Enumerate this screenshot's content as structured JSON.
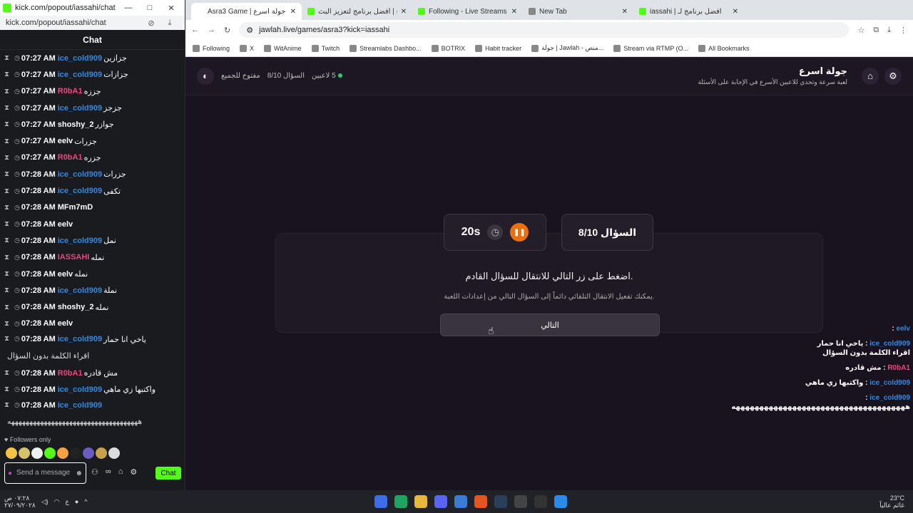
{
  "chat_window": {
    "title": "kick.com/popout/iassahi/chat - Google...",
    "url": "kick.com/popout/iassahi/chat",
    "header": "Chat",
    "followers_only": "Followers only",
    "input_placeholder": "Send a message",
    "send_label": "Chat",
    "messages": [
      {
        "time": "07:27 AM",
        "user": "ice_cold909",
        "user_color": "#2f8ae6",
        "text": "جزازين"
      },
      {
        "time": "07:27 AM",
        "user": "ice_cold909",
        "user_color": "#2f8ae6",
        "text": "جزازات"
      },
      {
        "time": "07:27 AM",
        "user": "R0bA1",
        "user_color": "#e64a7c",
        "text": "جززه"
      },
      {
        "time": "07:27 AM",
        "user": "ice_cold909",
        "user_color": "#2f8ae6",
        "text": "جزجز"
      },
      {
        "time": "07:27 AM",
        "user": "shoshy_2",
        "user_color": "#ffffff",
        "text": "جوازر"
      },
      {
        "time": "07:27 AM",
        "user": "eelv",
        "user_color": "#ffffff",
        "text": "جزرات"
      },
      {
        "time": "07:27 AM",
        "user": "R0bA1",
        "user_color": "#e64a7c",
        "text": "جزره"
      },
      {
        "time": "07:28 AM",
        "user": "ice_cold909",
        "user_color": "#2f8ae6",
        "text": "جزرات"
      },
      {
        "time": "07:28 AM",
        "user": "ice_cold909",
        "user_color": "#2f8ae6",
        "text": "تكفى"
      },
      {
        "time": "07:28 AM",
        "user": "MFm7mD",
        "user_color": "#ffffff",
        "text": ""
      },
      {
        "time": "07:28 AM",
        "user": "eelv",
        "user_color": "#ffffff",
        "text": ""
      },
      {
        "time": "07:28 AM",
        "user": "ice_cold909",
        "user_color": "#2f8ae6",
        "text": "نمل"
      },
      {
        "time": "07:28 AM",
        "user": "IASSAHI",
        "user_color": "#e64a7c",
        "text": "نمله"
      },
      {
        "time": "07:28 AM",
        "user": "eelv",
        "user_color": "#ffffff",
        "text": "نمله"
      },
      {
        "time": "07:28 AM",
        "user": "ice_cold909",
        "user_color": "#2f8ae6",
        "text": "نملة"
      },
      {
        "time": "07:28 AM",
        "user": "shoshy_2",
        "user_color": "#ffffff",
        "text": "نمله"
      },
      {
        "time": "07:28 AM",
        "user": "eelv",
        "user_color": "#ffffff",
        "text": ""
      },
      {
        "time": "07:28 AM",
        "user": "ice_cold909",
        "user_color": "#2f8ae6",
        "text": "ياخي انا حمار",
        "text2": "اقراء الكلمة بدون السؤال"
      },
      {
        "time": "07:28 AM",
        "user": "R0bA1",
        "user_color": "#e64a7c",
        "text": "مش قادره"
      },
      {
        "time": "07:28 AM",
        "user": "ice_cold909",
        "user_color": "#2f8ae6",
        "text": "واكتبها زي ماهي"
      },
      {
        "time": "07:28 AM",
        "user": "ice_cold909",
        "user_color": "#2f8ae6",
        "text": "",
        "text2": "ههههههههههههههههههههههههههههههههههههه"
      }
    ]
  },
  "browser": {
    "tabs": [
      {
        "title": "Asra3 Game | جولة اسرع",
        "color": "#ffffff"
      },
      {
        "title": "الولاء | أفضل برنامج لتعزيز البث",
        "color": "#53fc18"
      },
      {
        "title": "Following - Live Streams on Kick",
        "color": "#53fc18"
      },
      {
        "title": "New Tab",
        "color": "#888888"
      },
      {
        "title": "iassahi | أفضل برنامج لـ",
        "color": "#53fc18"
      }
    ],
    "url": "jawlah.live/games/asra3?kick=iassahi",
    "bookmarks": [
      "Following",
      "X",
      "WitAnime",
      "Twitch",
      "Streamlabs Dashbo...",
      "BOTRIX",
      "Habit tracker",
      "جولة | Jawlah - منص...",
      "Stream via RTMP (O...",
      "All Bookmarks"
    ]
  },
  "game": {
    "title": "جولة اسرع",
    "subtitle": "لعبة سرعة وتحدي للاعبين الأسرع في الإجابة على الأسئلة",
    "players": "5 لاعبين",
    "question_progress": "السؤال 8/10",
    "open_label": "مفتوح للجميع",
    "timer": "20s",
    "question_label": "السؤال 8/10",
    "instruction": "اضغط على زر التالي للانتقال للسؤال القادم.",
    "hint": "يمكنك تفعيل الانتقال التلقائي دائماً إلى السؤال التالي من إعدادات اللعبة.",
    "next_button": "التالي"
  },
  "overlay_chat": [
    {
      "user": "eelv",
      "text": ""
    },
    {
      "user": "ice_cold909",
      "text": "ياخي انا حمار اقراء الكلمة بدون السؤال"
    },
    {
      "user": "R0bA1",
      "text": "مش قادره"
    },
    {
      "user": "ice_cold909",
      "text": "واكتبها زي ماهي"
    },
    {
      "user": "ice_cold909",
      "text": "هههههههههههههههههههههههههههههههههههههه"
    }
  ],
  "taskbar": {
    "time": "٠٧:٢٨ ص",
    "date": "٢٧/٠٩/٢٠٢٨",
    "weather": "23°C",
    "weather_desc": "غائم عالياً"
  }
}
